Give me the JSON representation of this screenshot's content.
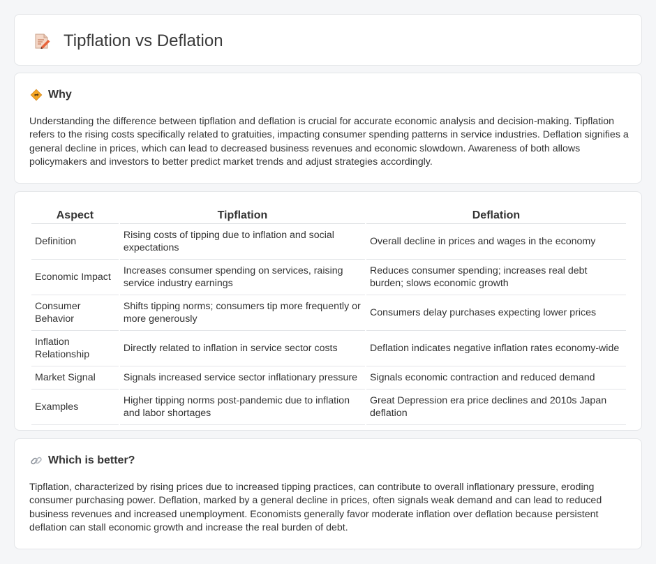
{
  "header": {
    "title": "Tipflation vs Deflation",
    "icon": "document-pencil-icon"
  },
  "why": {
    "title": "Why",
    "icon": "diamond-sign-icon",
    "text": "Understanding the difference between tipflation and deflation is crucial for accurate economic analysis and decision-making. Tipflation refers to the rising costs specifically related to gratuities, impacting consumer spending patterns in service industries. Deflation signifies a general decline in prices, which can lead to decreased business revenues and economic slowdown. Awareness of both allows policymakers and investors to better predict market trends and adjust strategies accordingly."
  },
  "table": {
    "headers": [
      "Aspect",
      "Tipflation",
      "Deflation"
    ],
    "rows": [
      {
        "aspect": "Definition",
        "tipflation": "Rising costs of tipping due to inflation and social expectations",
        "deflation": "Overall decline in prices and wages in the economy"
      },
      {
        "aspect": "Economic Impact",
        "tipflation": "Increases consumer spending on services, raising service industry earnings",
        "deflation": "Reduces consumer spending; increases real debt burden; slows economic growth"
      },
      {
        "aspect": "Consumer Behavior",
        "tipflation": "Shifts tipping norms; consumers tip more frequently or more generously",
        "deflation": "Consumers delay purchases expecting lower prices"
      },
      {
        "aspect": "Inflation Relationship",
        "tipflation": "Directly related to inflation in service sector costs",
        "deflation": "Deflation indicates negative inflation rates economy-wide"
      },
      {
        "aspect": "Market Signal",
        "tipflation": "Signals increased service sector inflationary pressure",
        "deflation": "Signals economic contraction and reduced demand"
      },
      {
        "aspect": "Examples",
        "tipflation": "Higher tipping norms post-pandemic due to inflation and labor shortages",
        "deflation": "Great Depression era price declines and 2010s Japan deflation"
      }
    ]
  },
  "better": {
    "title": "Which is better?",
    "icon": "link-icon",
    "text": "Tipflation, characterized by rising prices due to increased tipping practices, can contribute to overall inflationary pressure, eroding consumer purchasing power. Deflation, marked by a general decline in prices, often signals weak demand and can lead to reduced business revenues and increased unemployment. Economists generally favor moderate inflation over deflation because persistent deflation can stall economic growth and increase the real burden of debt."
  }
}
